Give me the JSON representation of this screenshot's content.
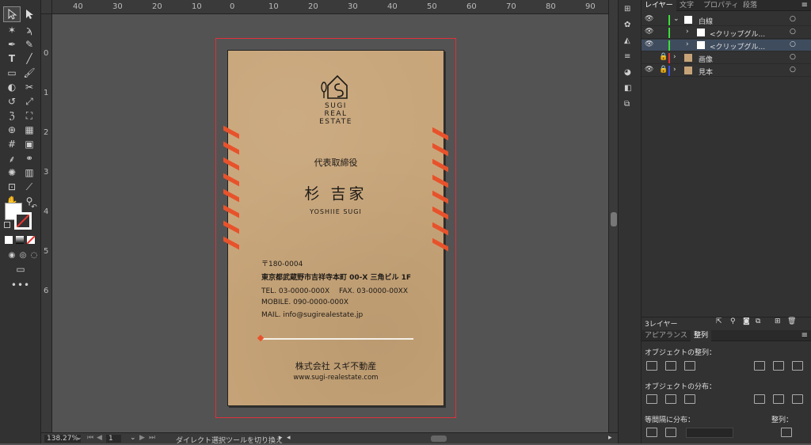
{
  "window": {
    "zoom": "138.27%",
    "page": "1",
    "status_tool": "ダイレクト選択ツールを切り換え"
  },
  "rulers": {
    "top": [
      "40",
      "30",
      "20",
      "10",
      "0",
      "10",
      "20",
      "30",
      "40",
      "50",
      "60",
      "70",
      "80",
      "90"
    ],
    "left": [
      "0",
      "1",
      "2",
      "3",
      "4",
      "5",
      "6"
    ]
  },
  "layers_panel": {
    "tabs": [
      "レイヤー",
      "文字",
      "プロパティ",
      "段落"
    ],
    "rows": [
      {
        "name": "白線",
        "color": "#3ddc3d"
      },
      {
        "name": "<クリップグル...",
        "color": "#3ddc3d"
      },
      {
        "name": "<クリップグル...",
        "color": "#3ddc3d"
      },
      {
        "name": "画像",
        "color": "#e03333"
      },
      {
        "name": "見本",
        "color": "#3a4fe0"
      }
    ],
    "footer_count": "3レイヤー"
  },
  "bottom_panel": {
    "tabs": [
      "アピアランス",
      "整列"
    ],
    "align_objects": "オブジェクトの整列：",
    "distribute_objects": "オブジェクトの分布：",
    "distribute_spacing": "等間隔に分布：",
    "align_to": "整列："
  },
  "card": {
    "logo_line1": "SUGI",
    "logo_line2": "REAL",
    "logo_line3": "ESTATE",
    "title": "代表取締役",
    "name": "杉 吉家",
    "name_roman": "YOSHIIE SUGI",
    "zip": "〒180-0004",
    "address": "東京都武蔵野市吉祥寺本町 00-X 三角ビル 1F",
    "tel_fax": "TEL. 03-0000-000X 　FAX. 03-0000-00XX",
    "mobile": "MOBILE. 090-0000-000X",
    "mail": "MAIL. info@sugirealestate.jp",
    "company": "株式会社 スギ不動産",
    "url": "www.sugi-realestate.com"
  },
  "colors": {
    "accent_marks": "#e8522b",
    "card_bg": "#c7a478",
    "bleed_line": "#e0303a"
  }
}
